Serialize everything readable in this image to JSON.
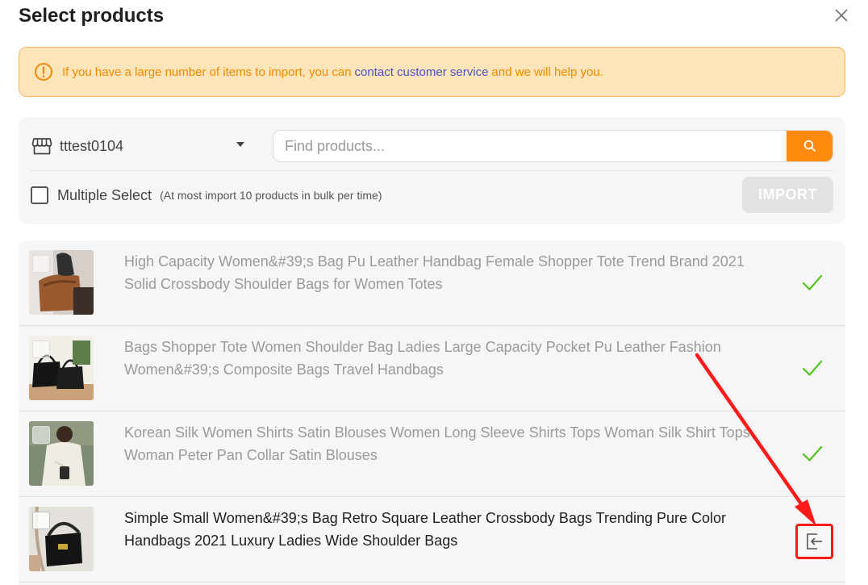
{
  "dialog": {
    "title": "Select products",
    "close_icon": "close-icon"
  },
  "notice": {
    "icon": "warning-circle-icon",
    "text_before": "If you have a large number of items to import, you can",
    "link": "contact customer service",
    "text_after": "and we will help you.",
    "color": "#f08a00"
  },
  "filters": {
    "store_icon": "store-icon",
    "store_name": "tttest0104",
    "search_placeholder": "Find products...",
    "search_value": "",
    "search_icon": "search-icon",
    "multiple_select_label": "Multiple Select",
    "multiple_select_hint": "(At most import 10 products in bulk per time)",
    "import_label": "IMPORT"
  },
  "products": [
    {
      "title": "High Capacity Women&#39;s Bag Pu Leather Handbag Female Shopper Tote Trend Brand 2021 Solid Crossbody Shoulder Bags for Women Totes",
      "status": "imported",
      "status_icon": "check-icon"
    },
    {
      "title": "Bags Shopper Tote Women Shoulder Bag Ladies Large Capacity Pocket Pu Leather Fashion Women&#39;s Composite Bags Travel Handbags",
      "status": "imported",
      "status_icon": "check-icon"
    },
    {
      "title": "Korean Silk Women Shirts Satin Blouses Women Long Sleeve Shirts Tops Woman Silk Shirt Tops Woman Peter Pan Collar Satin Blouses",
      "status": "imported",
      "status_icon": "check-icon"
    },
    {
      "title": "Simple Small Women&#39;s Bag Retro Square Leather Crossbody Bags Trending Pure Color Handbags 2021 Luxury Ladies Wide Shoulder Bags",
      "status": "not-imported",
      "status_icon": "import-icon"
    }
  ],
  "colors": {
    "accent": "#ff8a0d",
    "success": "#52c41a",
    "highlight": "#ff1a1a",
    "link": "#4b53c8"
  }
}
